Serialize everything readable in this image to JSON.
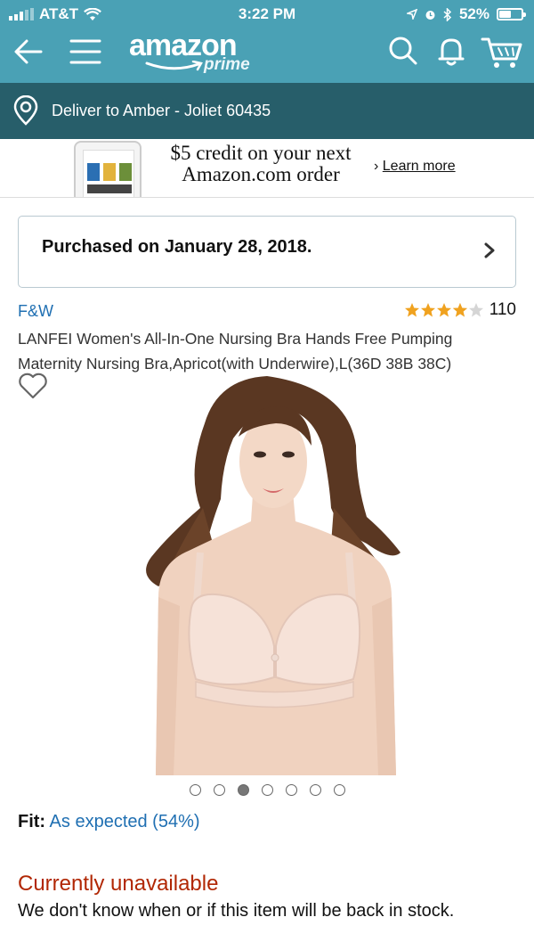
{
  "status_bar": {
    "carrier": "AT&T",
    "time": "3:22 PM",
    "battery": "52%"
  },
  "header": {
    "logo_word": "amazon",
    "logo_prime": "prime"
  },
  "delivery": {
    "label": "Deliver to Amber - Joliet 60435"
  },
  "promo": {
    "line1": "$5 credit on your next",
    "line2": "Amazon.com order",
    "link_prefix": "›",
    "link": "Learn more"
  },
  "purchase": {
    "label": "Purchased on January 28, 2018."
  },
  "product": {
    "brand": "F&W",
    "rating": 3.5,
    "review_count": "110",
    "title": "LANFEI Women's All-In-One Nursing Bra Hands Free Pumping Maternity Nursing Bra,Apricot(with Underwire),L(36D 38B 38C)",
    "image_count": 7,
    "image_selected": 3,
    "fit_label": "Fit:",
    "fit_value": "As expected (54%)",
    "availability": "Currently unavailable",
    "stock_note": "We don't know when or if this item will be back in stock."
  },
  "colors": {
    "header_teal": "#4aa1b5",
    "delivery_bar": "#275e6a",
    "link_blue": "#1f6fb2",
    "unavailable_red": "#b12704",
    "star_gold": "#f0a21f"
  }
}
